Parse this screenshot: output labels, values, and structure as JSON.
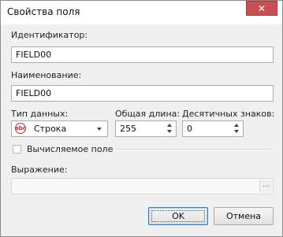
{
  "window": {
    "title": "Свойства поля",
    "close_glyph": "✕"
  },
  "identifier": {
    "label": "Идентификатор:",
    "value": "FIELD00"
  },
  "name": {
    "label": "Наименование:",
    "value": "FIELD00"
  },
  "data_type": {
    "label": "Тип данных:",
    "icon": "abc-string-icon",
    "icon_text": "abc",
    "value": "Строка"
  },
  "total_length": {
    "label": "Общая длина:",
    "value": "255"
  },
  "decimals": {
    "label": "Десятичных знаков:",
    "value": "0"
  },
  "computed": {
    "label": "Вычисляемое поле",
    "checked": false
  },
  "expression": {
    "label": "Выражение:",
    "value": "",
    "button_label": "..."
  },
  "buttons": {
    "ok": "OK",
    "cancel": "Отмена"
  },
  "colors": {
    "close_button": "#c75050",
    "default_button_border": "#3c7fb1",
    "type_icon": "#cc2a2a"
  }
}
